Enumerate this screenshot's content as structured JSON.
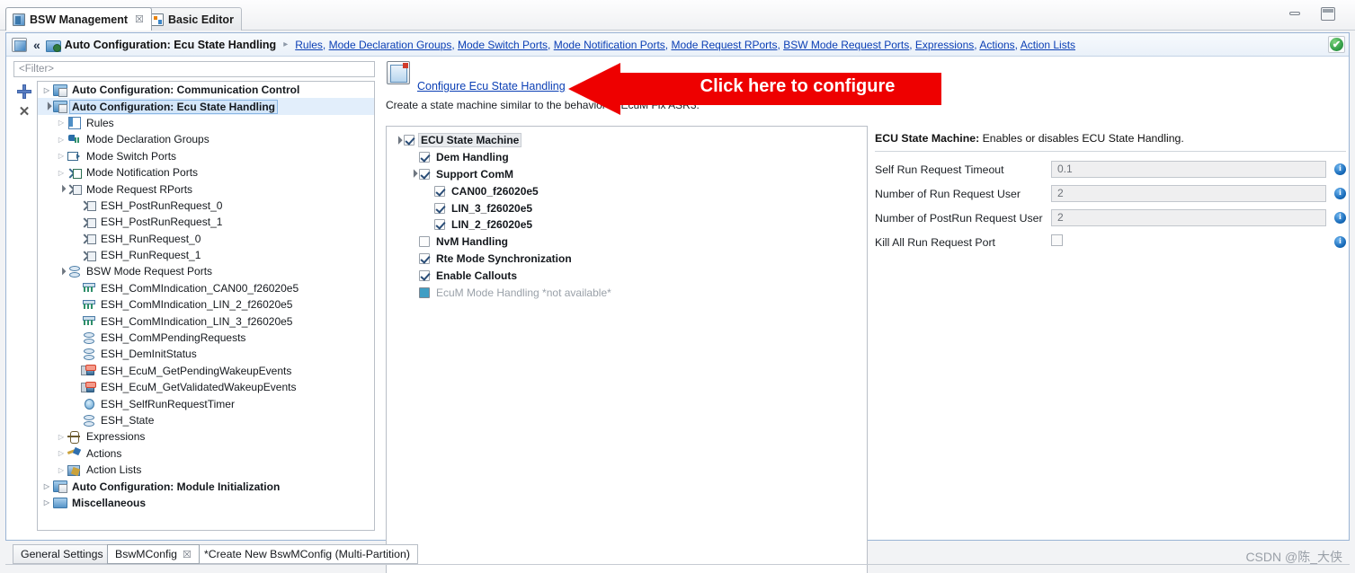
{
  "window": {
    "minimize_label": "minimize",
    "maximize_label": "restore"
  },
  "editor_tabs": [
    {
      "label": "BSW Management",
      "icon": "bsw-icon",
      "active": true,
      "close": "☒"
    },
    {
      "label": "Basic Editor",
      "icon": "basic-editor-icon",
      "active": false
    }
  ],
  "form_header": {
    "back_label": "«",
    "title": "Auto Configuration: Ecu State Handling",
    "separator": "▸",
    "breadcrumbs": [
      "Rules",
      "Mode Declaration Groups",
      "Mode Switch Ports",
      "Mode Notification Ports",
      "Mode Request RPorts",
      "BSW Mode Request Ports",
      "Expressions",
      "Actions",
      "Action Lists"
    ],
    "status_icon": "✔"
  },
  "filter": {
    "placeholder": "<Filter>",
    "value": "<Filter>"
  },
  "side_tools": [
    {
      "name": "add-button",
      "label": "+"
    },
    {
      "name": "delete-button",
      "label": "✕"
    }
  ],
  "tree": [
    {
      "label": "Auto Configuration: Communication Control",
      "indent": 0,
      "twist": "closed",
      "icon": "i-folderdoc",
      "bold": true,
      "selected": false
    },
    {
      "label": "Auto Configuration: Ecu State Handling",
      "indent": 0,
      "twist": "open",
      "icon": "i-folderdoc",
      "bold": true,
      "selected": true
    },
    {
      "label": "Rules",
      "indent": 1,
      "twist": "closed",
      "icon": "i-rules",
      "bold": false,
      "selected": false
    },
    {
      "label": "Mode Declaration Groups",
      "indent": 1,
      "twist": "closed",
      "icon": "i-mdg",
      "bold": false,
      "selected": false
    },
    {
      "label": "Mode Switch Ports",
      "indent": 1,
      "twist": "closed",
      "icon": "i-msp",
      "bold": false,
      "selected": false
    },
    {
      "label": "Mode Notification Ports",
      "indent": 1,
      "twist": "closed",
      "icon": "i-mnp",
      "bold": false,
      "selected": false
    },
    {
      "label": "Mode Request RPorts",
      "indent": 1,
      "twist": "open",
      "icon": "i-mrp",
      "bold": false,
      "selected": false
    },
    {
      "label": "ESH_PostRunRequest_0",
      "indent": 2,
      "twist": "none",
      "icon": "i-mrp",
      "bold": false,
      "selected": false
    },
    {
      "label": "ESH_PostRunRequest_1",
      "indent": 2,
      "twist": "none",
      "icon": "i-mrp",
      "bold": false,
      "selected": false
    },
    {
      "label": "ESH_RunRequest_0",
      "indent": 2,
      "twist": "none",
      "icon": "i-mrp",
      "bold": false,
      "selected": false
    },
    {
      "label": "ESH_RunRequest_1",
      "indent": 2,
      "twist": "none",
      "icon": "i-mrp",
      "bold": false,
      "selected": false
    },
    {
      "label": "BSW Mode Request Ports",
      "indent": 1,
      "twist": "open",
      "icon": "i-bswport",
      "bold": false,
      "selected": false
    },
    {
      "label": "ESH_ComMIndication_CAN00_f26020e5",
      "indent": 2,
      "twist": "none",
      "icon": "i-comm",
      "bold": false,
      "selected": false
    },
    {
      "label": "ESH_ComMIndication_LIN_2_f26020e5",
      "indent": 2,
      "twist": "none",
      "icon": "i-comm",
      "bold": false,
      "selected": false
    },
    {
      "label": "ESH_ComMIndication_LIN_3_f26020e5",
      "indent": 2,
      "twist": "none",
      "icon": "i-comm",
      "bold": false,
      "selected": false
    },
    {
      "label": "ESH_ComMPendingRequests",
      "indent": 2,
      "twist": "none",
      "icon": "i-bswport",
      "bold": false,
      "selected": false
    },
    {
      "label": "ESH_DemInitStatus",
      "indent": 2,
      "twist": "none",
      "icon": "i-bswport",
      "bold": false,
      "selected": false
    },
    {
      "label": "ESH_EcuM_GetPendingWakeupEvents",
      "indent": 2,
      "twist": "none",
      "icon": "i-ecum",
      "bold": false,
      "selected": false
    },
    {
      "label": "ESH_EcuM_GetValidatedWakeupEvents",
      "indent": 2,
      "twist": "none",
      "icon": "i-ecum",
      "bold": false,
      "selected": false
    },
    {
      "label": "ESH_SelfRunRequestTimer",
      "indent": 2,
      "twist": "none",
      "icon": "i-timer",
      "bold": false,
      "selected": false
    },
    {
      "label": "ESH_State",
      "indent": 2,
      "twist": "none",
      "icon": "i-bswport",
      "bold": false,
      "selected": false
    },
    {
      "label": "Expressions",
      "indent": 1,
      "twist": "closed",
      "icon": "i-expr",
      "bold": false,
      "selected": false
    },
    {
      "label": "Actions",
      "indent": 1,
      "twist": "closed",
      "icon": "i-actions",
      "bold": false,
      "selected": false
    },
    {
      "label": "Action Lists",
      "indent": 1,
      "twist": "closed",
      "icon": "i-actionlist",
      "bold": false,
      "selected": false
    },
    {
      "label": "Auto Configuration: Module Initialization",
      "indent": 0,
      "twist": "closed",
      "icon": "i-folderdoc",
      "bold": true,
      "selected": false
    },
    {
      "label": "Miscellaneous",
      "indent": 0,
      "twist": "closed",
      "icon": "i-folder",
      "bold": true,
      "selected": false
    }
  ],
  "config": {
    "link_label": "Configure Ecu State Handling",
    "description": "Create a state machine similar to the behavior of EcuM Fix ASR3.",
    "items": [
      {
        "label": "ECU State Machine",
        "indent": 0,
        "twist": "open",
        "state": "checked",
        "dim": false,
        "selected": true
      },
      {
        "label": "Dem Handling",
        "indent": 1,
        "twist": "none",
        "state": "checked",
        "dim": false,
        "selected": false
      },
      {
        "label": "Support ComM",
        "indent": 1,
        "twist": "open",
        "state": "checked",
        "dim": false,
        "selected": false
      },
      {
        "label": "CAN00_f26020e5",
        "indent": 2,
        "twist": "none",
        "state": "checked",
        "dim": false,
        "selected": false
      },
      {
        "label": "LIN_3_f26020e5",
        "indent": 2,
        "twist": "none",
        "state": "checked",
        "dim": false,
        "selected": false
      },
      {
        "label": "LIN_2_f26020e5",
        "indent": 2,
        "twist": "none",
        "state": "checked",
        "dim": false,
        "selected": false
      },
      {
        "label": "NvM Handling",
        "indent": 1,
        "twist": "none",
        "state": "unchecked",
        "dim": false,
        "selected": false
      },
      {
        "label": "Rte Mode Synchronization",
        "indent": 1,
        "twist": "none",
        "state": "checked",
        "dim": false,
        "selected": false
      },
      {
        "label": "Enable Callouts",
        "indent": 1,
        "twist": "none",
        "state": "checked",
        "dim": false,
        "selected": false
      },
      {
        "label": "EcuM Mode Handling *not available*",
        "indent": 1,
        "twist": "none",
        "state": "gray",
        "dim": true,
        "selected": false
      }
    ]
  },
  "properties": {
    "title_bold": "ECU State Machine:",
    "title_rest": " Enables or disables ECU State Handling.",
    "rows": [
      {
        "label": "Self Run Request Timeout",
        "type": "text",
        "value": "0.1",
        "info": "i"
      },
      {
        "label": "Number of Run Request User",
        "type": "text",
        "value": "2",
        "info": "i"
      },
      {
        "label": "Number of PostRun Request User",
        "type": "text",
        "value": "2",
        "info": "i"
      },
      {
        "label": "Kill All Run Request Port",
        "type": "checkbox",
        "value": "",
        "info": "i"
      }
    ]
  },
  "callout": {
    "text": "Click here to configure",
    "color": "#ee0000",
    "text_color": "#ffffff"
  },
  "bottom_tabs": [
    {
      "label": "General Settings",
      "active": false,
      "close": ""
    },
    {
      "label": "BswMConfig",
      "active": true,
      "close": "☒"
    },
    {
      "label": "*Create New BswMConfig (Multi-Partition)",
      "active": false,
      "close": ""
    }
  ],
  "watermark": "CSDN @陈_大侠"
}
